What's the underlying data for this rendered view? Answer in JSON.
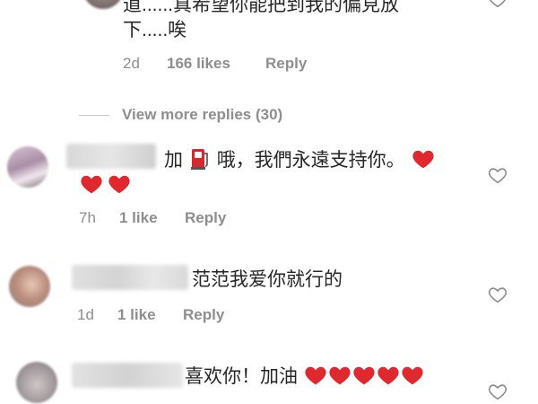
{
  "comment0": {
    "text_line1": "道......真希望你能把到我的偏見放",
    "text_line2": "下.....唉",
    "time": "2d",
    "likes": "166 likes",
    "reply": "Reply"
  },
  "view_more": {
    "label": "View more replies (30)"
  },
  "comment1": {
    "text_pre": "加",
    "text_post": "哦，我們永遠支持你。",
    "time": "7h",
    "likes": "1 like",
    "reply": "Reply"
  },
  "comment2": {
    "text": "范范我爱你就行的",
    "time": "1d",
    "likes": "1 like",
    "reply": "Reply"
  },
  "comment3": {
    "text": "喜欢你！加油"
  },
  "colors": {
    "heart": "#e0282f",
    "meta_gray": "#8e8e8e",
    "text": "#262626"
  },
  "icons": [
    "heart-outline-icon",
    "red-heart-emoji",
    "fuel-pump-emoji"
  ]
}
